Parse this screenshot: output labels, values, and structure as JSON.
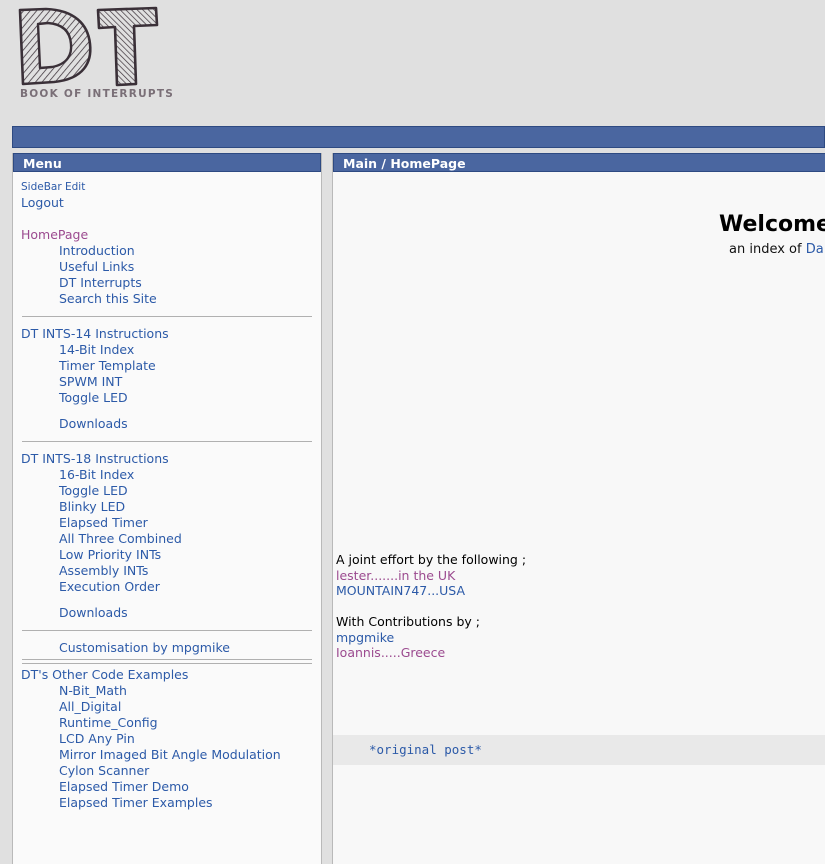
{
  "logo": {
    "letters": "DT",
    "subtitle": "BOOK OF INTERRUPTS"
  },
  "sidebar": {
    "title": "Menu",
    "groups": [
      {
        "items": [
          {
            "label": "SideBar Edit",
            "style": "small",
            "indent": false,
            "visited": false
          },
          {
            "label": "Logout",
            "style": "normal",
            "indent": false,
            "visited": false
          }
        ]
      },
      {
        "items": [
          {
            "label": "HomePage",
            "style": "normal",
            "indent": false,
            "visited": true
          },
          {
            "label": "Introduction",
            "style": "normal",
            "indent": true,
            "visited": false
          },
          {
            "label": "Useful Links",
            "style": "normal",
            "indent": true,
            "visited": false
          },
          {
            "label": "DT Interrupts",
            "style": "normal",
            "indent": true,
            "visited": false
          },
          {
            "label": "Search this Site",
            "style": "normal",
            "indent": true,
            "visited": false
          }
        ]
      },
      {
        "items": [
          {
            "label": "DT INTS-14 Instructions",
            "style": "normal",
            "indent": false,
            "visited": false
          },
          {
            "label": "14-Bit Index",
            "style": "normal",
            "indent": true,
            "visited": false
          },
          {
            "label": "Timer Template",
            "style": "normal",
            "indent": true,
            "visited": false
          },
          {
            "label": "SPWM INT",
            "style": "normal",
            "indent": true,
            "visited": false
          },
          {
            "label": "Toggle LED",
            "style": "normal",
            "indent": true,
            "visited": false
          },
          {
            "label": "Downloads",
            "style": "normal",
            "indent": true,
            "visited": false,
            "spaced": true
          }
        ]
      },
      {
        "items": [
          {
            "label": "DT INTS-18 Instructions",
            "style": "normal",
            "indent": false,
            "visited": false
          },
          {
            "label": "16-Bit Index",
            "style": "normal",
            "indent": true,
            "visited": false
          },
          {
            "label": "Toggle LED",
            "style": "normal",
            "indent": true,
            "visited": false
          },
          {
            "label": "Blinky LED",
            "style": "normal",
            "indent": true,
            "visited": false
          },
          {
            "label": "Elapsed Timer",
            "style": "normal",
            "indent": true,
            "visited": false
          },
          {
            "label": "All Three Combined",
            "style": "normal",
            "indent": true,
            "visited": false
          },
          {
            "label": "Low Priority INTs",
            "style": "normal",
            "indent": true,
            "visited": false
          },
          {
            "label": "Assembly INTs",
            "style": "normal",
            "indent": true,
            "visited": false
          },
          {
            "label": "Execution Order",
            "style": "normal",
            "indent": true,
            "visited": false
          },
          {
            "label": "Downloads",
            "style": "normal",
            "indent": true,
            "visited": false,
            "spaced": true
          }
        ]
      },
      {
        "items": [
          {
            "label": "Customisation by mpgmike",
            "style": "normal",
            "indent": true,
            "visited": false
          }
        ]
      },
      {
        "items": [
          {
            "label": "DT's Other Code Examples",
            "style": "normal",
            "indent": false,
            "visited": false
          },
          {
            "label": "N-Bit_Math",
            "style": "normal",
            "indent": true,
            "visited": false
          },
          {
            "label": "All_Digital",
            "style": "normal",
            "indent": true,
            "visited": false
          },
          {
            "label": "Runtime_Config",
            "style": "normal",
            "indent": true,
            "visited": false
          },
          {
            "label": "LCD Any Pin",
            "style": "normal",
            "indent": true,
            "visited": false
          },
          {
            "label": "Mirror Imaged Bit Angle Modulation",
            "style": "normal",
            "indent": true,
            "visited": false
          },
          {
            "label": "Cylon Scanner",
            "style": "normal",
            "indent": true,
            "visited": false
          },
          {
            "label": "Elapsed Timer Demo",
            "style": "normal",
            "indent": true,
            "visited": false
          },
          {
            "label": "Elapsed Timer Examples",
            "style": "normal",
            "indent": true,
            "visited": false
          }
        ]
      }
    ]
  },
  "main": {
    "breadcrumb": "Main / HomePage",
    "welcome_heading": "Welcome t",
    "subtitle_prefix": "an index of ",
    "subtitle_link": "Da",
    "credits": {
      "joint_heading": "A joint effort by the following ;",
      "joint_names": [
        {
          "text": "lester.......in the UK",
          "color": "purple"
        },
        {
          "text": "MOUNTAIN747...USA",
          "color": "blue"
        }
      ],
      "contrib_heading": "With Contributions by ;",
      "contrib_names": [
        {
          "text": "mpgmike",
          "color": "blue"
        },
        {
          "text": "Ioannis.....Greece",
          "color": "purple"
        }
      ]
    },
    "code_text": "*original post*"
  },
  "colors": {
    "header_blue": "#4a66a0",
    "link_blue": "#2c5aa8",
    "visited_purple": "#9b4a8f",
    "page_bg": "#e0e0e0",
    "panel_bg": "#f8f8f8",
    "code_bg": "#e9e9e9"
  }
}
